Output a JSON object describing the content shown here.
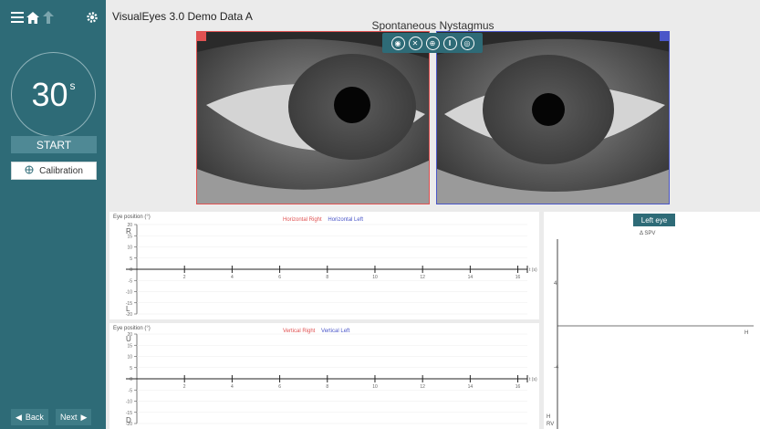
{
  "app": {
    "title": "VisualEyes 3.0 Demo Data A",
    "test_name": "Spontaneous Nystagmus"
  },
  "sidebar": {
    "timer_value": "30",
    "timer_unit": "s",
    "start_label": "START",
    "calibration_label": "Calibration",
    "back_label": "Back",
    "next_label": "Next"
  },
  "horizontal_plot": {
    "axis_label": "Eye position (°)",
    "upper_side_label": "R",
    "lower_side_label": "L",
    "legend": [
      "Horizontal Right",
      "Horizontal Left"
    ],
    "y_ticks": [
      "20",
      "15",
      "10",
      "5",
      "0",
      "-5",
      "-10",
      "-15",
      "-20"
    ],
    "x_ticks": [
      "2",
      "4",
      "6",
      "8",
      "10",
      "12",
      "14",
      "16"
    ],
    "x_unit": "t (s)"
  },
  "vertical_plot": {
    "axis_label": "Eye position (°)",
    "upper_side_label": "U",
    "lower_side_label": "D",
    "legend": [
      "Vertical Right",
      "Vertical Left"
    ],
    "y_ticks": [
      "20",
      "15",
      "10",
      "5",
      "0",
      "-5",
      "-10",
      "-15",
      "-20"
    ],
    "x_ticks": [
      "2",
      "4",
      "6",
      "8",
      "10",
      "12",
      "14",
      "16"
    ],
    "x_unit": "t (s)"
  },
  "spv_panel": {
    "tab_label": "Left eye",
    "title": "Δ SPV",
    "y_upper_tick": "4",
    "y_lower_tick": "-4",
    "x_right_label": "H",
    "bottom_labels": [
      "H",
      "RV"
    ]
  },
  "colors": {
    "right_eye": "#e05252",
    "left_eye": "#4a56c8",
    "accent": "#2e6b77"
  }
}
